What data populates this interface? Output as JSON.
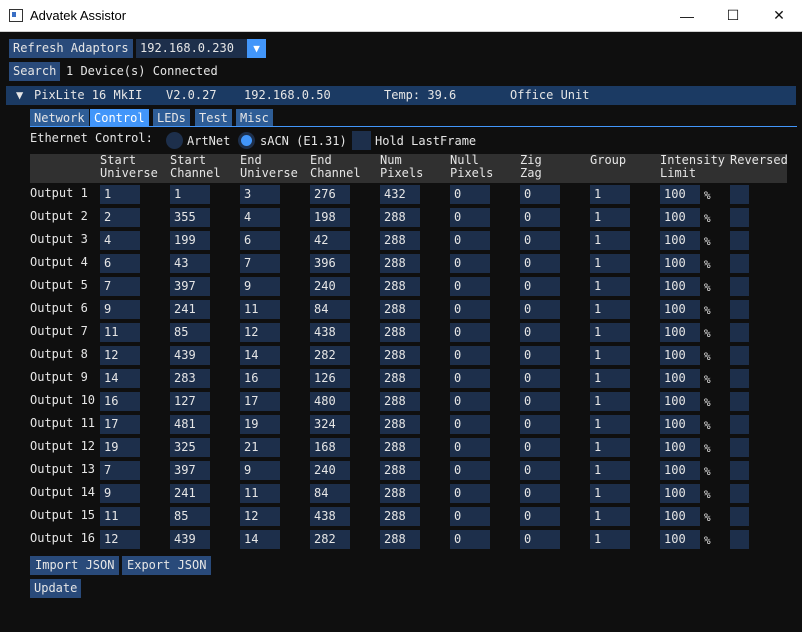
{
  "window": {
    "title": "Advatek Assistor",
    "minimize": "—",
    "maximize": "☐",
    "close": "✕"
  },
  "toolbar": {
    "refresh_label": "Refresh Adaptors",
    "ip_selected": "192.168.0.230",
    "dropdown_arrow": "▼",
    "search_label": "Search",
    "device_count": "1 Device(s) Connected"
  },
  "device": {
    "arrow": "▼",
    "name": "PixLite 16 MkII",
    "firmware": "V2.0.27",
    "ip": "192.168.0.50",
    "temp": "Temp: 39.6",
    "nickname": "Office Unit"
  },
  "tabs": [
    "Network",
    "Control",
    "LEDs",
    "Test",
    "Misc"
  ],
  "active_tab": "Control",
  "ethernet": {
    "label": "Ethernet Control:",
    "options": [
      "ArtNet",
      "sACN (E1.31)"
    ],
    "selected": "sACN (E1.31)",
    "hold_label": "Hold LastFrame"
  },
  "table": {
    "headers": [
      [
        "Start",
        "Universe"
      ],
      [
        "Start",
        "Channel"
      ],
      [
        "End",
        "Universe"
      ],
      [
        "End",
        "Channel"
      ],
      [
        "Num",
        "Pixels"
      ],
      [
        "Null",
        "Pixels"
      ],
      [
        "Zig",
        "Zag"
      ],
      [
        "Group",
        ""
      ],
      [
        "Intensity",
        "Limit"
      ],
      [
        "Reversed",
        ""
      ]
    ],
    "percent": "%",
    "rows": [
      {
        "label": "Output 1",
        "start_universe": "1",
        "start_channel": "1",
        "end_universe": "3",
        "end_channel": "276",
        "num_pixels": "432",
        "null_pixels": "0",
        "zig_zag": "0",
        "group": "1",
        "intensity": "100"
      },
      {
        "label": "Output 2",
        "start_universe": "2",
        "start_channel": "355",
        "end_universe": "4",
        "end_channel": "198",
        "num_pixels": "288",
        "null_pixels": "0",
        "zig_zag": "0",
        "group": "1",
        "intensity": "100"
      },
      {
        "label": "Output 3",
        "start_universe": "4",
        "start_channel": "199",
        "end_universe": "6",
        "end_channel": "42",
        "num_pixels": "288",
        "null_pixels": "0",
        "zig_zag": "0",
        "group": "1",
        "intensity": "100"
      },
      {
        "label": "Output 4",
        "start_universe": "6",
        "start_channel": "43",
        "end_universe": "7",
        "end_channel": "396",
        "num_pixels": "288",
        "null_pixels": "0",
        "zig_zag": "0",
        "group": "1",
        "intensity": "100"
      },
      {
        "label": "Output 5",
        "start_universe": "7",
        "start_channel": "397",
        "end_universe": "9",
        "end_channel": "240",
        "num_pixels": "288",
        "null_pixels": "0",
        "zig_zag": "0",
        "group": "1",
        "intensity": "100"
      },
      {
        "label": "Output 6",
        "start_universe": "9",
        "start_channel": "241",
        "end_universe": "11",
        "end_channel": "84",
        "num_pixels": "288",
        "null_pixels": "0",
        "zig_zag": "0",
        "group": "1",
        "intensity": "100"
      },
      {
        "label": "Output 7",
        "start_universe": "11",
        "start_channel": "85",
        "end_universe": "12",
        "end_channel": "438",
        "num_pixels": "288",
        "null_pixels": "0",
        "zig_zag": "0",
        "group": "1",
        "intensity": "100"
      },
      {
        "label": "Output 8",
        "start_universe": "12",
        "start_channel": "439",
        "end_universe": "14",
        "end_channel": "282",
        "num_pixels": "288",
        "null_pixels": "0",
        "zig_zag": "0",
        "group": "1",
        "intensity": "100"
      },
      {
        "label": "Output 9",
        "start_universe": "14",
        "start_channel": "283",
        "end_universe": "16",
        "end_channel": "126",
        "num_pixels": "288",
        "null_pixels": "0",
        "zig_zag": "0",
        "group": "1",
        "intensity": "100"
      },
      {
        "label": "Output 10",
        "start_universe": "16",
        "start_channel": "127",
        "end_universe": "17",
        "end_channel": "480",
        "num_pixels": "288",
        "null_pixels": "0",
        "zig_zag": "0",
        "group": "1",
        "intensity": "100"
      },
      {
        "label": "Output 11",
        "start_universe": "17",
        "start_channel": "481",
        "end_universe": "19",
        "end_channel": "324",
        "num_pixels": "288",
        "null_pixels": "0",
        "zig_zag": "0",
        "group": "1",
        "intensity": "100"
      },
      {
        "label": "Output 12",
        "start_universe": "19",
        "start_channel": "325",
        "end_universe": "21",
        "end_channel": "168",
        "num_pixels": "288",
        "null_pixels": "0",
        "zig_zag": "0",
        "group": "1",
        "intensity": "100"
      },
      {
        "label": "Output 13",
        "start_universe": "7",
        "start_channel": "397",
        "end_universe": "9",
        "end_channel": "240",
        "num_pixels": "288",
        "null_pixels": "0",
        "zig_zag": "0",
        "group": "1",
        "intensity": "100"
      },
      {
        "label": "Output 14",
        "start_universe": "9",
        "start_channel": "241",
        "end_universe": "11",
        "end_channel": "84",
        "num_pixels": "288",
        "null_pixels": "0",
        "zig_zag": "0",
        "group": "1",
        "intensity": "100"
      },
      {
        "label": "Output 15",
        "start_universe": "11",
        "start_channel": "85",
        "end_universe": "12",
        "end_channel": "438",
        "num_pixels": "288",
        "null_pixels": "0",
        "zig_zag": "0",
        "group": "1",
        "intensity": "100"
      },
      {
        "label": "Output 16",
        "start_universe": "12",
        "start_channel": "439",
        "end_universe": "14",
        "end_channel": "282",
        "num_pixels": "288",
        "null_pixels": "0",
        "zig_zag": "0",
        "group": "1",
        "intensity": "100"
      }
    ]
  },
  "actions": {
    "import_label": "Import JSON",
    "export_label": "Export JSON",
    "update_label": "Update"
  },
  "colors": {
    "accent": "#4296fa",
    "button": "#294a7a",
    "field": "#1d2f4b",
    "header": "#1b3a63",
    "background": "#0f0f0f"
  }
}
